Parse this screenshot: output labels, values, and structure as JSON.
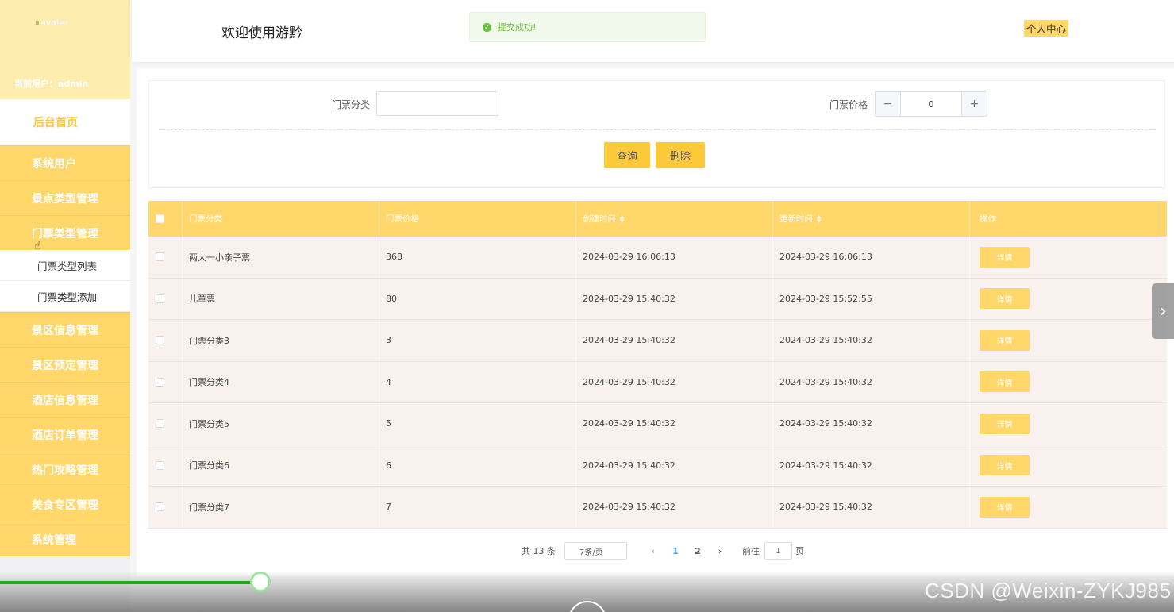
{
  "sidebar": {
    "avatar_alt": "avatar",
    "current_user": "当前用户：admin",
    "home": "后台首页",
    "items": [
      {
        "label": "系统用户"
      },
      {
        "label": "景点类型管理"
      },
      {
        "label": "门票类型管理"
      },
      {
        "label": "景区信息管理"
      },
      {
        "label": "景区预定管理"
      },
      {
        "label": "酒店信息管理"
      },
      {
        "label": "酒店订单管理"
      },
      {
        "label": "热门攻略管理"
      },
      {
        "label": "美食专区管理"
      },
      {
        "label": "系统管理"
      }
    ],
    "sub_items": [
      {
        "label": "门票类型列表"
      },
      {
        "label": "门票类型添加"
      }
    ]
  },
  "header": {
    "title": "欢迎使用游黔",
    "toast": "提交成功!",
    "profile": "个人中心"
  },
  "search": {
    "category_label": "门票分类",
    "category_value": "",
    "price_label": "门票价格",
    "price_value": "0",
    "query_button": "查询",
    "delete_button": "删除"
  },
  "table": {
    "columns": [
      "门票分类",
      "门票价格",
      "创建时间",
      "更新时间",
      "操作"
    ],
    "detail_label": "详情",
    "rows": [
      {
        "category": "两大一小亲子票",
        "price": "368",
        "created": "2024-03-29 16:06:13",
        "updated": "2024-03-29 16:06:13"
      },
      {
        "category": "儿童票",
        "price": "80",
        "created": "2024-03-29 15:40:32",
        "updated": "2024-03-29 15:52:55"
      },
      {
        "category": "门票分类3",
        "price": "3",
        "created": "2024-03-29 15:40:32",
        "updated": "2024-03-29 15:40:32"
      },
      {
        "category": "门票分类4",
        "price": "4",
        "created": "2024-03-29 15:40:32",
        "updated": "2024-03-29 15:40:32"
      },
      {
        "category": "门票分类5",
        "price": "5",
        "created": "2024-03-29 15:40:32",
        "updated": "2024-03-29 15:40:32"
      },
      {
        "category": "门票分类6",
        "price": "6",
        "created": "2024-03-29 15:40:32",
        "updated": "2024-03-29 15:40:32"
      },
      {
        "category": "门票分类7",
        "price": "7",
        "created": "2024-03-29 15:40:32",
        "updated": "2024-03-29 15:40:32"
      }
    ]
  },
  "pagination": {
    "total": "共 13 条",
    "page_size": "7条/页",
    "pages": [
      "1",
      "2"
    ],
    "current_page": "1",
    "goto_label": "前往",
    "goto_value": "1",
    "page_suffix": "页"
  },
  "video": {
    "progress": 0.22,
    "watermark": "CSDN @Weixin-ZYKJ985"
  },
  "colors": {
    "accent": "#ffd76a",
    "button": "#fcc93a",
    "success": "#67c23a",
    "link": "#409eff"
  }
}
